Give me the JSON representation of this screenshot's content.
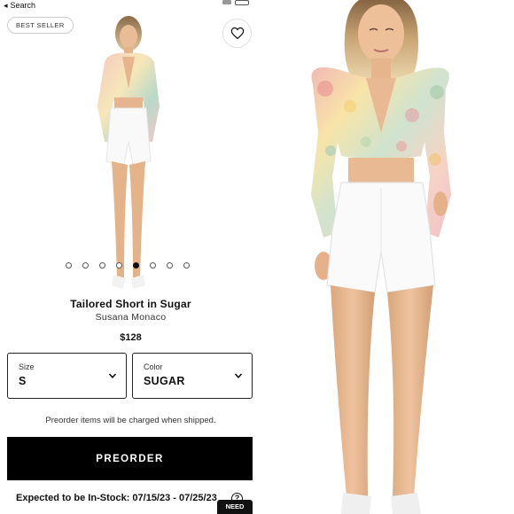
{
  "statusbar": {
    "back_arrow": "◂",
    "back_label": "Search"
  },
  "badges": {
    "best_seller": "BEST SELLER"
  },
  "gallery": {
    "image_count": 8,
    "active_index": 4
  },
  "product": {
    "name": "Tailored Short in Sugar",
    "brand": "Susana Monaco",
    "price": "$128"
  },
  "size_select": {
    "label": "Size",
    "value": "S"
  },
  "color_select": {
    "label": "Color",
    "value": "SUGAR"
  },
  "preorder": {
    "note": "Preorder items will be charged when shipped.",
    "button_label": "PREORDER",
    "instock": "Expected to be In-Stock: 07/15/23 - 07/25/23",
    "help_glyph": "?"
  },
  "chat": {
    "label": "NEED"
  },
  "icons": [
    "heart-icon",
    "chevron-down-icon",
    "help-icon",
    "back-arrow-icon"
  ],
  "colors": {
    "primary": "#000000",
    "text": "#111111",
    "background": "#ffffff"
  }
}
